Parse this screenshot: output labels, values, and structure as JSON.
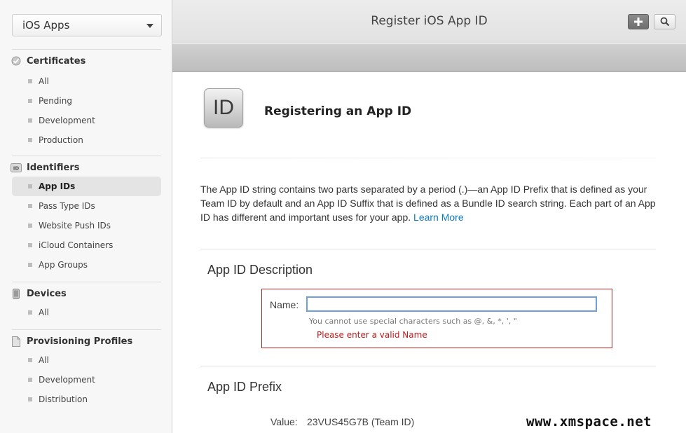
{
  "sidebar": {
    "platform": "iOS Apps",
    "sections": [
      {
        "title": "Certificates",
        "icon": "certificate-icon",
        "items": [
          "All",
          "Pending",
          "Development",
          "Production"
        ]
      },
      {
        "title": "Identifiers",
        "icon": "id-badge-icon",
        "items": [
          "App IDs",
          "Pass Type IDs",
          "Website Push IDs",
          "iCloud Containers",
          "App Groups"
        ],
        "selected": "App IDs"
      },
      {
        "title": "Devices",
        "icon": "device-icon",
        "items": [
          "All"
        ]
      },
      {
        "title": "Provisioning Profiles",
        "icon": "document-icon",
        "items": [
          "All",
          "Development",
          "Distribution"
        ]
      }
    ]
  },
  "header": {
    "title": "Register iOS App ID",
    "add_icon": "plus-icon",
    "search_icon": "search-icon"
  },
  "main": {
    "icon_text": "ID",
    "title": "Registering an App ID",
    "intro_text": "The App ID string contains two parts separated by a period (.)—an App ID Prefix that is defined as your Team ID by default and an App ID Suffix that is defined as a Bundle ID search string. Each part of an App ID has different and important uses for your app. ",
    "learn_more": "Learn More",
    "description": {
      "heading": "App ID Description",
      "name_label": "Name:",
      "name_value": "",
      "hint": "You cannot use special characters such as @, &, *, ', \"",
      "error": "Please enter a valid Name"
    },
    "prefix": {
      "heading": "App ID Prefix",
      "value_label": "Value:",
      "value": "23VUS45G7B (Team ID)"
    }
  },
  "watermark": "www.xmspace.net",
  "colors": {
    "link": "#0b7bc4",
    "error": "#c01a1a",
    "error_border": "#cc1f1f",
    "input_focus": "#6f9fd6"
  }
}
